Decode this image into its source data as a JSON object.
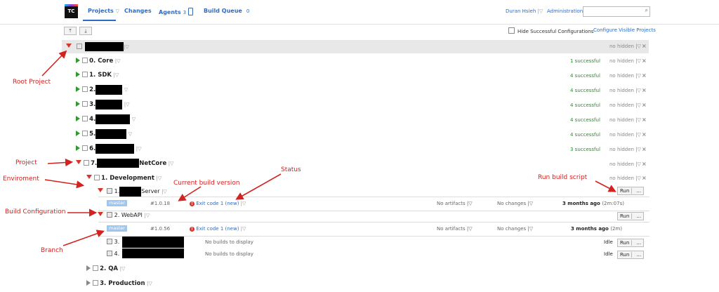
{
  "header": {
    "logo": "TC",
    "nav": {
      "projects": "Projects",
      "changes": "Changes",
      "agents": "Agents",
      "agents_count": "3",
      "build_queue": "Build Queue",
      "build_queue_count": "0"
    },
    "user": "Duran Hsieh",
    "administration": "Administration"
  },
  "toolbar": {
    "hide_successful": "Hide Successful Configurations",
    "configure": "Configure Visible Projects"
  },
  "common": {
    "no_hidden": "no hidden",
    "close": "×",
    "run": "Run",
    "dots": "...",
    "idle": "Idle",
    "no_builds": "No builds to display"
  },
  "projects": [
    {
      "name": "0. Core",
      "status": "1 successful"
    },
    {
      "name": "1. SDK",
      "status": "4 successful"
    },
    {
      "name": "2.",
      "status": "4 successful"
    },
    {
      "name": "3.",
      "status": "4 successful"
    },
    {
      "name": "4.",
      "status": "4 successful"
    },
    {
      "name": "5.",
      "status": "4 successful"
    },
    {
      "name": "6.",
      "status": "3 successful"
    }
  ],
  "project7": {
    "prefix": "7.",
    "suffix": "NetCore"
  },
  "environment": {
    "name": "1. Development"
  },
  "config1": {
    "prefix": "1.",
    "suffix": "Server",
    "branch": "master",
    "version": "#1.0.18",
    "status": "Exit code 1 (new)",
    "artifacts": "No artifacts",
    "changes": "No changes",
    "time": "3 months ago",
    "duration": "(2m:07s)"
  },
  "config2": {
    "name": "2. WebAPI",
    "branch": "master",
    "version": "#1.0.56",
    "status": "Exit code 1 (new)",
    "artifacts": "No artifacts",
    "changes": "No changes",
    "time": "3 months ago",
    "duration": "(2m)"
  },
  "config3": {
    "name": "3."
  },
  "config4": {
    "name": "4."
  },
  "qa": {
    "name": "2. QA"
  },
  "production": {
    "name": "3. Production"
  },
  "annotations": {
    "root_project": "Root Project",
    "project": "Project",
    "environment": "Enviroment",
    "build_configuration": "Build Configuration",
    "branch": "Branch",
    "current_build_version": "Current build  version",
    "status": "Status",
    "run_build_script": "Run build script"
  },
  "colors": {
    "link": "#2d6cc5",
    "success": "#2e8b2e",
    "annotation": "#d1231f",
    "branch": "#9ec7ef"
  }
}
